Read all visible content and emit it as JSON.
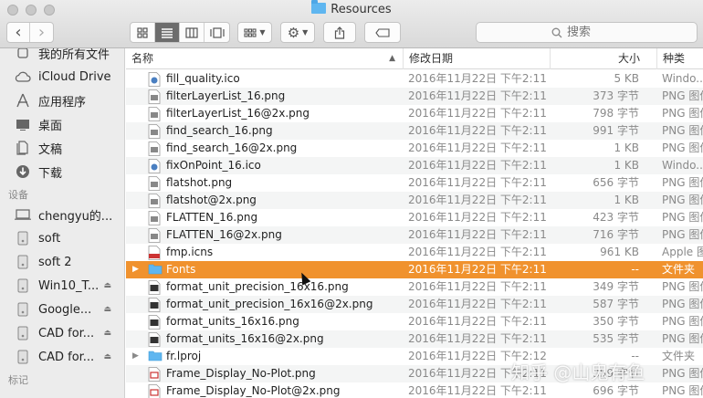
{
  "window": {
    "title": "Resources"
  },
  "toolbar": {
    "back_glyph": "‹",
    "forward_glyph": "›",
    "view_modes": [
      "icon-view",
      "list-view",
      "column-view",
      "gallery-view"
    ],
    "search_placeholder": "搜索"
  },
  "sidebar": {
    "favorites": [
      {
        "label": "我的所有文件",
        "icon": "all-files-icon"
      },
      {
        "label": "iCloud Drive",
        "icon": "cloud-icon"
      },
      {
        "label": "应用程序",
        "icon": "applications-icon"
      },
      {
        "label": "桌面",
        "icon": "desktop-icon"
      },
      {
        "label": "文稿",
        "icon": "documents-icon"
      },
      {
        "label": "下载",
        "icon": "downloads-icon"
      }
    ],
    "devices_header": "设备",
    "devices": [
      {
        "label": "chengyu的...",
        "icon": "computer-icon",
        "eject": false
      },
      {
        "label": "soft",
        "icon": "disk-icon",
        "eject": false
      },
      {
        "label": "soft 2",
        "icon": "disk-icon",
        "eject": false
      },
      {
        "label": "Win10_T...",
        "icon": "disk-icon",
        "eject": true
      },
      {
        "label": "Google...",
        "icon": "disk-icon",
        "eject": true
      },
      {
        "label": "CAD for...",
        "icon": "disk-icon",
        "eject": true
      },
      {
        "label": "CAD for...",
        "icon": "disk-icon",
        "eject": true
      }
    ],
    "tags_header": "标记"
  },
  "columns": {
    "name": "名称",
    "date": "修改日期",
    "size": "大小",
    "kind": "种类"
  },
  "files": [
    {
      "name": "fill_quality.ico",
      "date": "2016年11月22日 下午2:11",
      "size": "5 KB",
      "kind": "Windo...",
      "type": "ico"
    },
    {
      "name": "filterLayerList_16.png",
      "date": "2016年11月22日 下午2:11",
      "size": "373 字节",
      "kind": "PNG 图像",
      "type": "png"
    },
    {
      "name": "filterLayerList_16@2x.png",
      "date": "2016年11月22日 下午2:11",
      "size": "798 字节",
      "kind": "PNG 图像",
      "type": "png"
    },
    {
      "name": "find_search_16.png",
      "date": "2016年11月22日 下午2:11",
      "size": "991 字节",
      "kind": "PNG 图像",
      "type": "png"
    },
    {
      "name": "find_search_16@2x.png",
      "date": "2016年11月22日 下午2:11",
      "size": "1 KB",
      "kind": "PNG 图像",
      "type": "png"
    },
    {
      "name": "fixOnPoint_16.ico",
      "date": "2016年11月22日 下午2:11",
      "size": "1 KB",
      "kind": "Windo...",
      "type": "ico"
    },
    {
      "name": "flatshot.png",
      "date": "2016年11月22日 下午2:11",
      "size": "656 字节",
      "kind": "PNG 图像",
      "type": "png"
    },
    {
      "name": "flatshot@2x.png",
      "date": "2016年11月22日 下午2:11",
      "size": "1 KB",
      "kind": "PNG 图像",
      "type": "png"
    },
    {
      "name": "FLATTEN_16.png",
      "date": "2016年11月22日 下午2:11",
      "size": "423 字节",
      "kind": "PNG 图像",
      "type": "png"
    },
    {
      "name": "FLATTEN_16@2x.png",
      "date": "2016年11月22日 下午2:11",
      "size": "716 字节",
      "kind": "PNG 图像",
      "type": "png"
    },
    {
      "name": "fmp.icns",
      "date": "2016年11月22日 下午2:11",
      "size": "961 KB",
      "kind": "Apple 图标",
      "type": "icns"
    },
    {
      "name": "Fonts",
      "date": "2016年11月22日 下午2:11",
      "size": "--",
      "kind": "文件夹",
      "type": "folder",
      "selected": true
    },
    {
      "name": "format_unit_precision_16x16.png",
      "date": "2016年11月22日 下午2:11",
      "size": "349 字节",
      "kind": "PNG 图像",
      "type": "png-dark"
    },
    {
      "name": "format_unit_precision_16x16@2x.png",
      "date": "2016年11月22日 下午2:11",
      "size": "587 字节",
      "kind": "PNG 图像",
      "type": "png-dark"
    },
    {
      "name": "format_units_16x16.png",
      "date": "2016年11月22日 下午2:11",
      "size": "350 字节",
      "kind": "PNG 图像",
      "type": "png-dark"
    },
    {
      "name": "format_units_16x16@2x.png",
      "date": "2016年11月22日 下午2:11",
      "size": "535 字节",
      "kind": "PNG 图像",
      "type": "png-dark"
    },
    {
      "name": "fr.lproj",
      "date": "2016年11月22日 下午2:12",
      "size": "--",
      "kind": "文件夹",
      "type": "folder"
    },
    {
      "name": "Frame_Display_No-Plot.png",
      "date": "2016年11月22日 下午2:11",
      "size": "359 字节",
      "kind": "PNG 图像",
      "type": "png-red"
    },
    {
      "name": "Frame_Display_No-Plot@2x.png",
      "date": "2016年11月22日 下午2:11",
      "size": "696 字节",
      "kind": "PNG 图像",
      "type": "png-red"
    }
  ],
  "watermark": "知乎 @山鬼有鱼",
  "colors": {
    "selection": "#f0922e",
    "folder": "#5fb6f0"
  }
}
